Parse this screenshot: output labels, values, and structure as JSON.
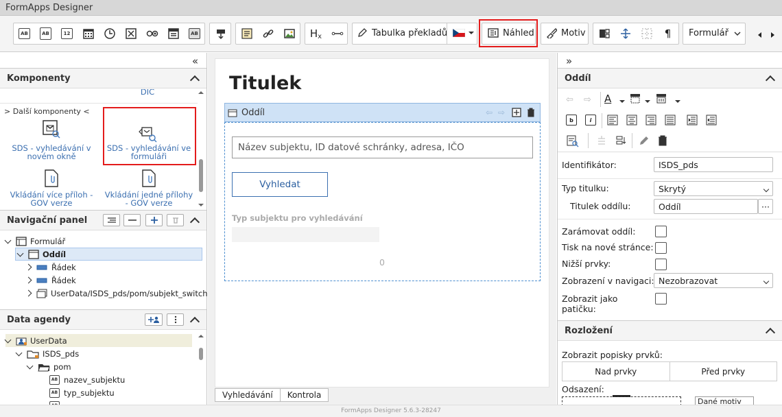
{
  "app": {
    "title": "FormApps Designer",
    "version": "FormApps Designer 5.6.3-28247"
  },
  "toolbar": {
    "icon_buttons": [
      "text-field-icon",
      "text-area-icon",
      "number-field-icon",
      "date-field-icon",
      "time-field-icon",
      "checkbox-icon",
      "radio-icon",
      "select-icon",
      "label-icon",
      "button-icon",
      "html-icon",
      "link-icon",
      "image-icon",
      "heading-icon",
      "separator-icon"
    ],
    "labels": {
      "ab": "AB",
      "num": "12",
      "heading": "H",
      "heading_sub": "x"
    },
    "translations_label": "Tabulka překladů",
    "preview_label": "Náhled",
    "theme_label": "Motiv",
    "form_select": "Formulář"
  },
  "left": {
    "collapse": "«",
    "components": {
      "title": "Komponenty",
      "prev_label": "DIČ",
      "more_label": "> Další komponenty <",
      "items": [
        {
          "label": "SDS - vyhledávání v novém okně"
        },
        {
          "label": "SDS - vyhledávání ve formuláři"
        },
        {
          "label": "Vkládání více příloh - GOV verze"
        },
        {
          "label": "Vkládání jedné přílohy - GOV verze"
        }
      ]
    },
    "navigation": {
      "title": "Navigační panel",
      "tree": [
        {
          "label": "Formulář",
          "level": 0,
          "expanded": true
        },
        {
          "label": "Oddíl",
          "level": 1,
          "expanded": true,
          "selected": true
        },
        {
          "label": "Řádek",
          "level": 2,
          "expanded": false
        },
        {
          "label": "Řádek",
          "level": 2,
          "expanded": false
        },
        {
          "label": "UserData/ISDS_pds/pom/subjekt_switch",
          "level": 2,
          "expanded": false
        }
      ]
    },
    "data": {
      "title": "Data agendy",
      "tree": [
        {
          "label": "UserData",
          "level": 0,
          "expanded": true
        },
        {
          "label": "ISDS_pds",
          "level": 1,
          "expanded": true
        },
        {
          "label": "pom",
          "level": 2,
          "expanded": true
        },
        {
          "label": "nazev_subjektu",
          "level": 3
        },
        {
          "label": "typ_subjektu",
          "level": 3
        }
      ]
    }
  },
  "canvas": {
    "title": "Titulek",
    "section_label": "Oddíl",
    "search_placeholder": "Název subjektu, ID datové schránky, adresa, IČO",
    "search_button": "Vyhledat",
    "subject_type_label": "Typ subjektu pro vyhledávání",
    "counter": "0",
    "tabs": [
      "Vyhledávání",
      "Kontrola"
    ]
  },
  "right": {
    "collapse": "»",
    "section": {
      "title": "Oddíl",
      "identifier_label": "Identifikátor:",
      "identifier_value": "ISDS_pds",
      "title_type_label": "Typ titulku:",
      "title_type_value": "Skrytý",
      "section_title_label": "Titulek oddílu:",
      "section_title_value": "Oddíl",
      "ellipsis": "···",
      "frame_label": "Zarámovat oddíl:",
      "new_page_label": "Tisk na nové stránce:",
      "lower_label": "Nižší prvky:",
      "nav_display_label": "Zobrazení v navigaci:",
      "nav_display_value": "Nezobrazovat",
      "footer_label": "Zobrazit jako patičku:"
    },
    "layout": {
      "title": "Rozložení",
      "show_labels": "Zobrazit popisky prvků:",
      "above": "Nad prvky",
      "before": "Před prvky",
      "indent_label": "Odsazení:",
      "theme_select": "Dané motiv"
    },
    "format_icons": {
      "bold": "b",
      "italic": "i",
      "font": "A"
    }
  }
}
